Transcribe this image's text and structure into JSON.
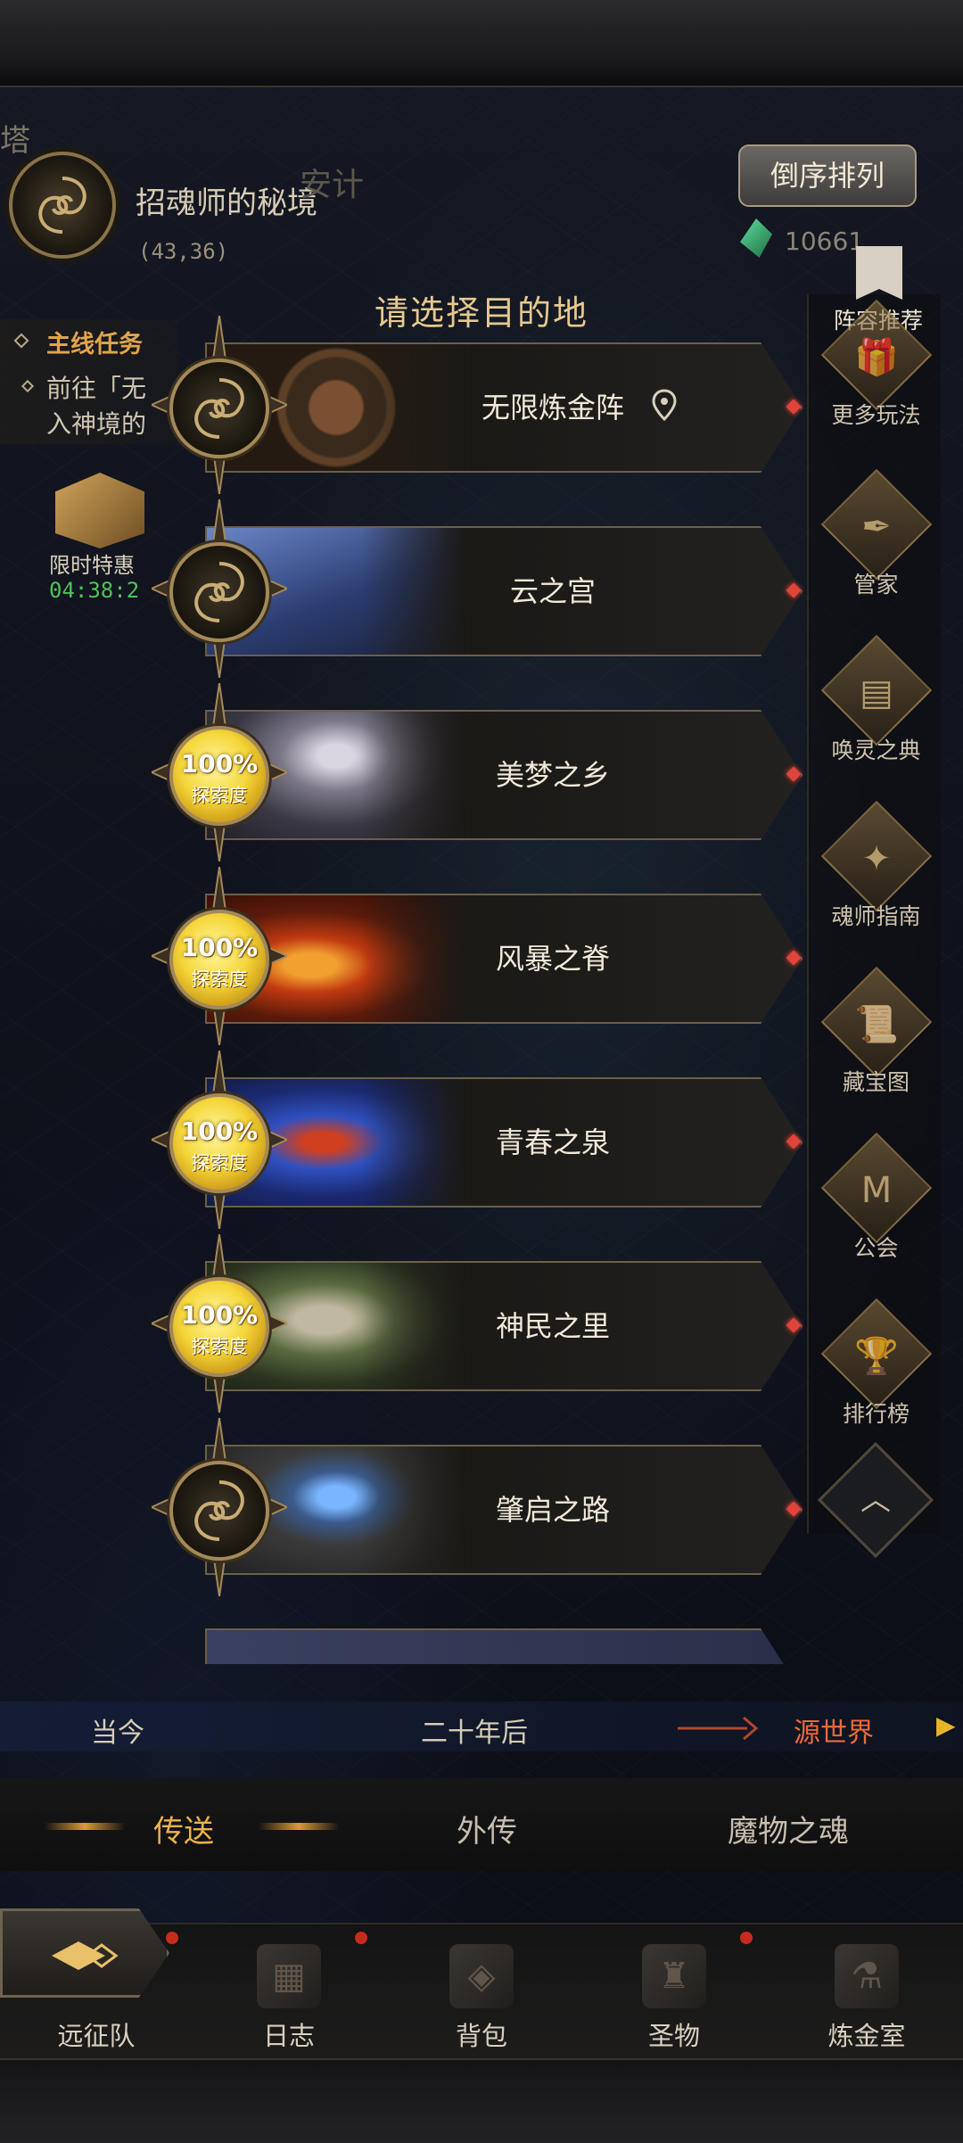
{
  "location": {
    "corner_char": "塔",
    "name": "招魂师的秘境",
    "coords": "(43,36)",
    "safe_zone": "安计"
  },
  "quest": {
    "title": "主线任务",
    "text_line1": "前往「无",
    "text_line2": "入神境的"
  },
  "limited_offer": {
    "label": "限时特惠",
    "timer": "04:38:2"
  },
  "sort_button": "倒序排列",
  "currency": {
    "value": "10661",
    "icon": "green-gem-icon"
  },
  "destination_title": "请选择目的地",
  "destinations": [
    {
      "name": "无限炼金阵",
      "pin": true,
      "explored": false
    },
    {
      "name": "云之宫",
      "explored": false
    },
    {
      "name": "美梦之乡",
      "explored": true,
      "progress": "100%",
      "progress_label": "探索度"
    },
    {
      "name": "风暴之脊",
      "explored": true,
      "progress": "100%",
      "progress_label": "探索度"
    },
    {
      "name": "青春之泉",
      "explored": true,
      "progress": "100%",
      "progress_label": "探索度"
    },
    {
      "name": "神民之里",
      "explored": true,
      "progress": "100%",
      "progress_label": "探索度"
    },
    {
      "name": "肇启之路",
      "explored": false
    }
  ],
  "side_menu": {
    "top_item": "阵容推荐",
    "items": [
      "更多玩法",
      "管家",
      "唤灵之典",
      "魂师指南",
      "藏宝图",
      "公会",
      "排行榜"
    ],
    "icons": [
      "gift-icon",
      "quill-icon",
      "book-icon",
      "guide-icon",
      "scroll-icon",
      "guild-icon",
      "trophy-icon"
    ]
  },
  "era_bar": {
    "left": "当今",
    "middle": "二十年后",
    "right": "源世界"
  },
  "tabs": [
    "传送",
    "外传",
    "魔物之魂"
  ],
  "bottom_nav": [
    "远征队",
    "日志",
    "背包",
    "圣物",
    "炼金室"
  ],
  "colors": {
    "accent_gold": "#e6c98f",
    "active_tab": "#ecb24a",
    "era_active": "#ec6a3a",
    "quest_title": "#e1a54d",
    "timer_green": "#4ec257"
  }
}
